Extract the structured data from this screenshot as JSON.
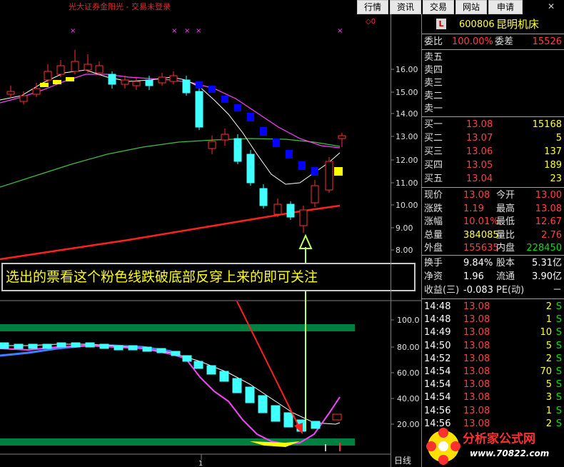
{
  "topbar": {
    "broker_text": "光大证券金阳光 - 交易未登录",
    "buttons": [
      "行情",
      "资讯",
      "交易",
      "网站",
      "申请"
    ],
    "close_symbol": "✕"
  },
  "annotation": {
    "text": "选出的票看这个粉色线跌破底部反穿上来的即可关注"
  },
  "main_chart": {
    "y_ticks": [
      "16.00",
      "15.00",
      "14.00",
      "13.00",
      "12.00",
      "11.00",
      "10.00",
      "9.00",
      "8.00"
    ],
    "top_marker": "◇0"
  },
  "ind_chart": {
    "y_ticks": [
      "100.0",
      "80.00",
      "60.00",
      "40.00",
      "20.00"
    ],
    "x_tick": "1"
  },
  "period": "日线",
  "panel": {
    "badge": "L",
    "code": "600806",
    "name": "昆明机床",
    "weibi_label": "委比",
    "weibi_value": "100.00%",
    "weicha_label": "委差",
    "weicha_value": "15526",
    "sell": [
      {
        "label": "卖五"
      },
      {
        "label": "卖四"
      },
      {
        "label": "卖三"
      },
      {
        "label": "卖二"
      },
      {
        "label": "卖一"
      }
    ],
    "buy": [
      {
        "label": "买一",
        "price": "13.08",
        "vol": "15168"
      },
      {
        "label": "买二",
        "price": "13.07",
        "vol": "5"
      },
      {
        "label": "买三",
        "price": "13.06",
        "vol": "137"
      },
      {
        "label": "买四",
        "price": "13.05",
        "vol": "189"
      },
      {
        "label": "买五",
        "price": "13.04",
        "vol": "23"
      }
    ],
    "stats": [
      {
        "l1": "现价",
        "v1": "13.08",
        "c1": "red",
        "l2": "今开",
        "v2": "13.00",
        "c2": "red"
      },
      {
        "l1": "涨跌",
        "v1": "1.19",
        "c1": "red",
        "l2": "最高",
        "v2": "13.08",
        "c2": "red"
      },
      {
        "l1": "涨幅",
        "v1": "10.01%",
        "c1": "red",
        "l2": "最低",
        "v2": "12.67",
        "c2": "red"
      },
      {
        "l1": "总量",
        "v1": "384085",
        "c1": "yellow",
        "l2": "量比",
        "v2": "2.76",
        "c2": "red"
      },
      {
        "l1": "外盘",
        "v1": "155635",
        "c1": "red",
        "l2": "内盘",
        "v2": "228450",
        "c2": "green"
      }
    ],
    "stats2": [
      {
        "l1": "换手",
        "v1": "9.84%",
        "l2": "股本",
        "v2": "5.31亿"
      },
      {
        "l1": "净资",
        "v1": "1.96",
        "l2": "流通",
        "v2": "3.90亿"
      },
      {
        "l1": "收益(三)",
        "v1": "-0.083",
        "l2": "PE(动)",
        "v2": "－"
      }
    ],
    "ticks": [
      {
        "time": "14:48",
        "price": "13.08",
        "vol": "2",
        "side": "S"
      },
      {
        "time": "14:48",
        "price": "13.08",
        "vol": "1",
        "side": "S"
      },
      {
        "time": "14:49",
        "price": "13.08",
        "vol": "10",
        "side": "S"
      },
      {
        "time": "14:50",
        "price": "13.08",
        "vol": "5",
        "side": "S"
      },
      {
        "time": "14:52",
        "price": "13.08",
        "vol": "2",
        "side": "S"
      },
      {
        "time": "14:54",
        "price": "13.08",
        "vol": "70",
        "side": "S"
      },
      {
        "time": "14:54",
        "price": "13.08",
        "vol": "5",
        "side": "S"
      },
      {
        "time": "14:54",
        "price": "13.08",
        "vol": "3",
        "side": "S"
      },
      {
        "time": "14:56",
        "price": "13.08",
        "vol": "1",
        "side": "S"
      },
      {
        "time": "14:56",
        "price": "13.08",
        "vol": "2",
        "side": "S"
      }
    ]
  },
  "watermark": {
    "title": "分析家公式网",
    "url": "www.70822.com"
  },
  "colors": {
    "up": "#ff3030",
    "down_fill": "#40ffff",
    "ma_white": "#ffffff",
    "ma_pink": "#ff40ff",
    "ma_green": "#40c040",
    "ma_red": "#ff2020",
    "blue_block": "#0000ff",
    "yellow_block": "#ffff00",
    "band": "#008040"
  }
}
